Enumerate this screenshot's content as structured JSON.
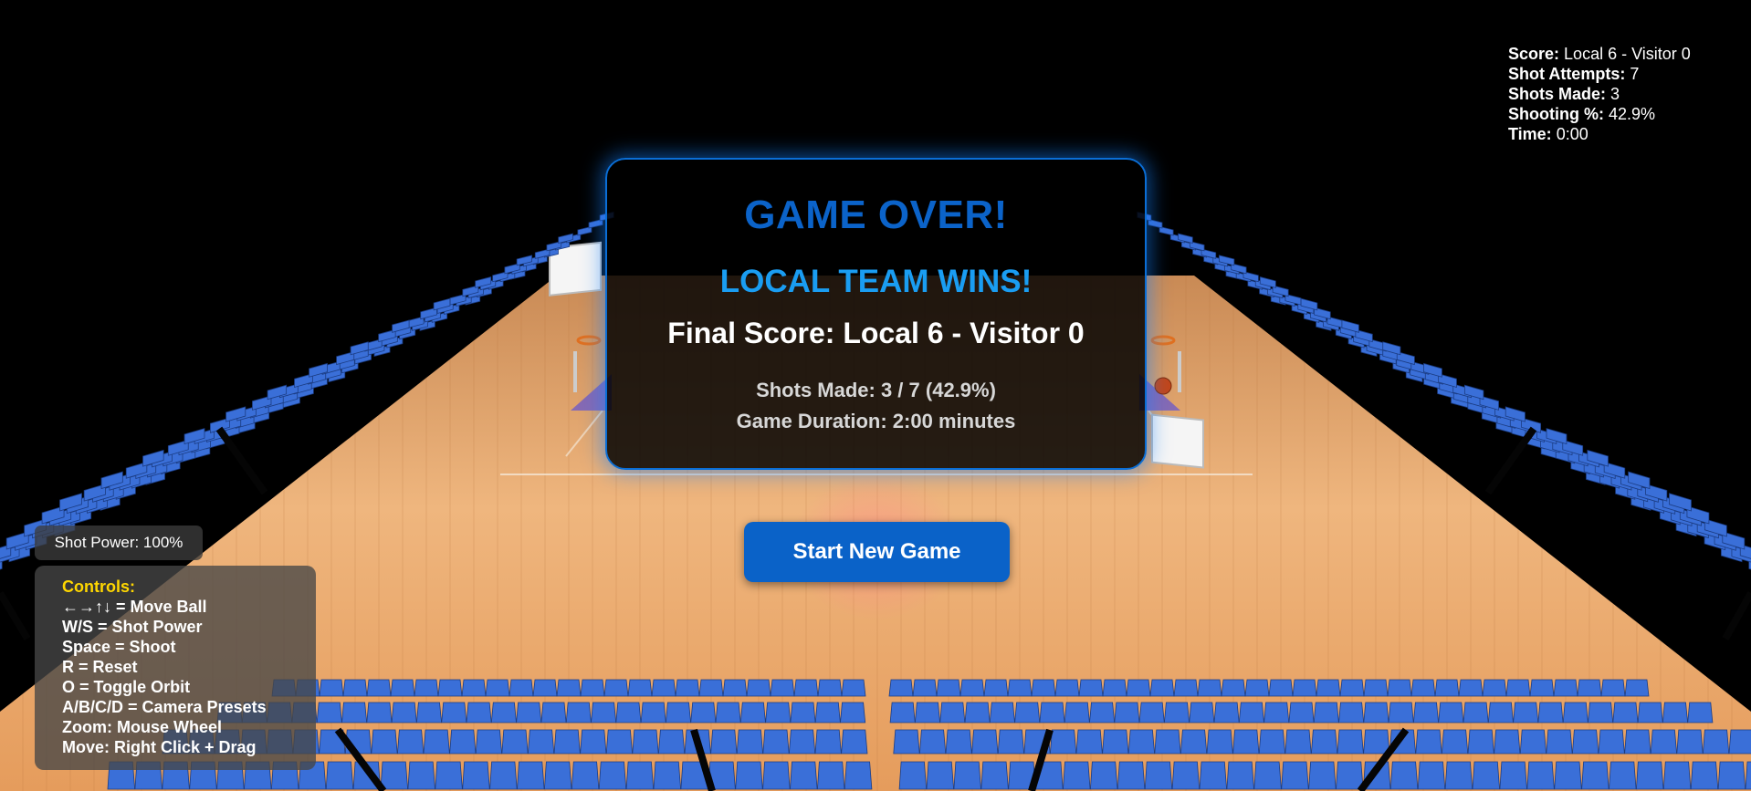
{
  "hud": {
    "score_label": "Score:",
    "score_value": "Local 6 - Visitor 0",
    "attempts_label": "Shot Attempts:",
    "attempts_value": "7",
    "made_label": "Shots Made:",
    "made_value": "3",
    "pct_label": "Shooting %:",
    "pct_value": "42.9%",
    "time_label": "Time:",
    "time_value": "0:00"
  },
  "modal": {
    "title": "GAME OVER!",
    "winner": "LOCAL TEAM WINS!",
    "final_score": "Final Score: Local 6 - Visitor 0",
    "shots_made": "Shots Made: 3 / 7 (42.9%)",
    "duration": "Game Duration: 2:00 minutes"
  },
  "start_button": "Start New Game",
  "shot_power": "Shot Power: 100%",
  "controls": {
    "title": "Controls:",
    "lines": [
      "←→↑↓ = Move Ball",
      "W/S = Shot Power",
      "Space = Shoot",
      "R = Reset",
      "O = Toggle Orbit",
      "A/B/C/D = Camera Presets",
      "Zoom: Mouse Wheel",
      "Move: Right Click + Drag"
    ]
  },
  "colors": {
    "accent": "#0b63c9",
    "winner": "#1a9df2",
    "controls_title": "#ffd700",
    "seat_blue": "#3a6fd8",
    "floor_wood": "#e9a66a"
  },
  "icons": [
    "basketball-icon",
    "hoop-icon"
  ]
}
